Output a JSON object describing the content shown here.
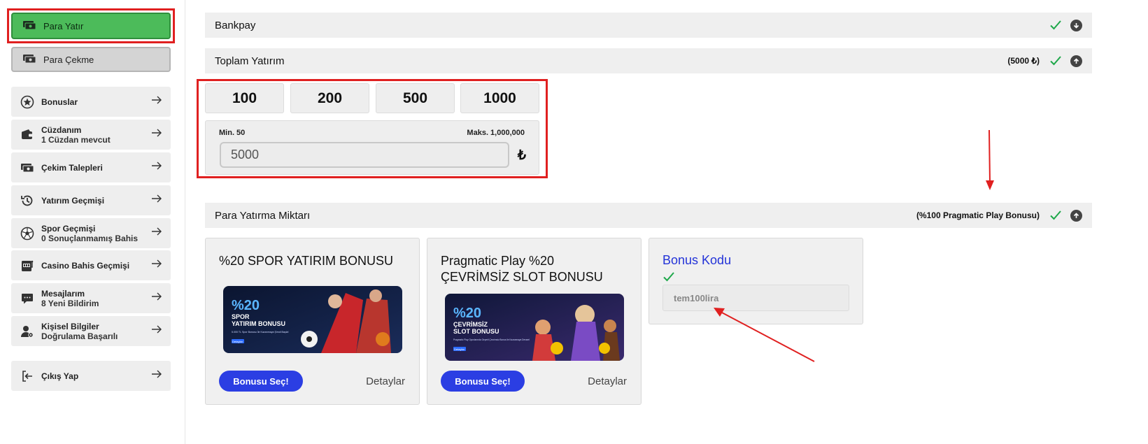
{
  "sidebar": {
    "deposit_label": "Para Yatır",
    "withdraw_label": "Para Çekme",
    "items": [
      {
        "label": "Bonuslar",
        "sub": "",
        "icon": "star-icon"
      },
      {
        "label": "Cüzdanım",
        "sub": "1 Cüzdan mevcut",
        "icon": "wallet-icon"
      },
      {
        "label": "Çekim Talepleri",
        "sub": "",
        "icon": "cash-withdraw-icon"
      },
      {
        "label": "Yatırım Geçmişi",
        "sub": "",
        "icon": "history-icon"
      },
      {
        "label": "Spor Geçmişi",
        "sub": "0 Sonuçlanmamış Bahis",
        "icon": "football-icon"
      },
      {
        "label": "Casino Bahis Geçmişi",
        "sub": "",
        "icon": "slot-machine-icon"
      },
      {
        "label": "Mesajlarım",
        "sub": "8 Yeni Bildirim",
        "icon": "message-icon"
      },
      {
        "label": "Kişisel Bilgiler",
        "sub": "Doğrulama Başarılı",
        "icon": "user-settings-icon"
      }
    ],
    "logout_label": "Çıkış Yap"
  },
  "sections": {
    "payment_method": {
      "title": "Bankpay"
    },
    "total_deposit": {
      "title": "Toplam Yatırım",
      "summary": "(5000 ₺)"
    },
    "deposit_amount": {
      "title": "Para Yatırma Miktarı",
      "summary": "(%100 Pragmatic Play Bonusu)"
    }
  },
  "amounts": {
    "presets": [
      "100",
      "200",
      "500",
      "1000"
    ],
    "min_label": "Min. 50",
    "max_label": "Maks. 1,000,000",
    "value": "5000",
    "currency": "₺"
  },
  "bonuses": [
    {
      "title": "%20 SPOR YATIRIM BONUSU",
      "banner": {
        "big": "%20",
        "line1": "SPOR",
        "line2": "YATIRIM BONUSU",
        "small": "5.000 TL Spor Bonusu İle Kazanmaya Şimdi Başla!",
        "details": "Detaylar"
      },
      "select_label": "Bonusu Seç!",
      "details_label": "Detaylar"
    },
    {
      "title": "Pragmatic Play %20 ÇEVRİMSİZ SLOT BONUSU",
      "banner": {
        "big": "%20",
        "line1": "ÇEVRİMSİZ",
        "line2": "SLOT BONUSU",
        "small": "Pragmatic Play Oyunlarında Geçerli Çevrimsiz Bonus ile Kazanmaya Devam!",
        "details": "Detaylar"
      },
      "select_label": "Bonusu Seç!",
      "details_label": "Detaylar"
    }
  ],
  "bonus_code": {
    "title": "Bonus Kodu",
    "value": "tem100lira"
  },
  "colors": {
    "deposit_green": "#4cbb5a",
    "check_green": "#1ea84a",
    "select_blue": "#2b3ee3",
    "annotation_red": "#e02020"
  }
}
